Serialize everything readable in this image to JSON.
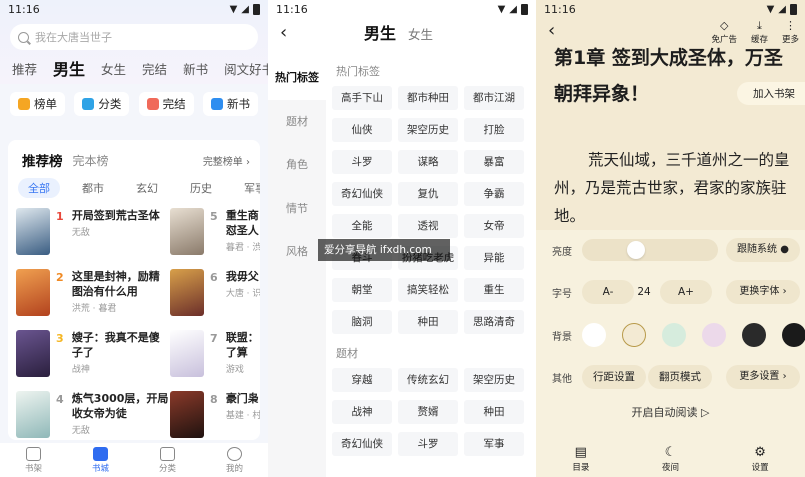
{
  "status": {
    "time": "11:16"
  },
  "home": {
    "search_placeholder": "我在大唐当世子",
    "tabs": [
      "推荐",
      "男生",
      "女生",
      "完结",
      "新书",
      "阅文好书"
    ],
    "active_tab": 1,
    "shortcuts": [
      {
        "label": "榜单",
        "color": "#f5a623"
      },
      {
        "label": "分类",
        "color": "#2fa3e6"
      },
      {
        "label": "完结",
        "color": "#f06a5a"
      },
      {
        "label": "新书",
        "color": "#2f8ef0"
      }
    ],
    "rank": {
      "title": "推荐榜",
      "subtitle": "完本榜",
      "more": "完整榜单",
      "chips": [
        "全部",
        "都市",
        "玄幻",
        "历史",
        "军事"
      ],
      "active_chip": 0,
      "books": [
        {
          "no": "1",
          "name": "开局签到荒古圣体",
          "author": "无敌",
          "cover": "#3a5d82",
          "color": "#e8473a"
        },
        {
          "no": "5",
          "name": "重生商",
          "name2": "怼圣人",
          "author": "暮君 · 渋",
          "cover": "#8a7a6a",
          "color": "#999999"
        },
        {
          "no": "2",
          "name": "这里是封神，励精图治有什么用",
          "author": "洪荒 · 暮君",
          "cover": "#b2421e",
          "color": "#f08a24"
        },
        {
          "no": "6",
          "name": "我毋父",
          "name2": "",
          "author": "大唐 · 识",
          "cover": "#6b2e2a",
          "color": "#999999"
        },
        {
          "no": "3",
          "name": "嫂子：我真不是傻子了",
          "author": "战神",
          "cover": "#2a1f3d",
          "color": "#f5b623"
        },
        {
          "no": "7",
          "name": "联盟：",
          "name2": "了算",
          "author": "游戏",
          "cover": "#e6e2f0",
          "color": "#999999"
        },
        {
          "no": "4",
          "name": "炼气3000层，开局收女帝为徒",
          "author": "无敌",
          "cover": "#c9dde0",
          "color": "#999999"
        },
        {
          "no": "8",
          "name": "豪门枭",
          "name2": "",
          "author": "基建 · 村",
          "cover": "#3a1f1a",
          "color": "#999999"
        }
      ]
    },
    "nav": [
      "书架",
      "书城",
      "分类",
      "我的"
    ],
    "active_nav": 1
  },
  "category": {
    "gender_active": "男生",
    "gender_other": "女生",
    "side": [
      "热门标签",
      "题材",
      "角色",
      "情节",
      "风格"
    ],
    "active_side": 0,
    "section1_title": "热门标签",
    "section1_tags": [
      "高手下山",
      "都市种田",
      "都市江湖",
      "仙侠",
      "架空历史",
      "打脸",
      "斗罗",
      "谋略",
      "暴富",
      "奇幻仙侠",
      "复仇",
      "争霸",
      "全能",
      "透视",
      "女帝",
      "眷斗",
      "扮猪吃老虎",
      "异能",
      "朝堂",
      "搞笑轻松",
      "重生",
      "脑洞",
      "种田",
      "思路清奇"
    ],
    "section2_title": "题材",
    "section2_tags": [
      "穿越",
      "传统玄幻",
      "架空历史",
      "战神",
      "赘婿",
      "种田",
      "奇幻仙侠",
      "斗罗",
      "军事"
    ]
  },
  "watermark": "爱分享导航 ifxdh.com",
  "reader": {
    "actions": [
      {
        "icon": "ad-free-icon",
        "glyph": "◇",
        "label": "免广告"
      },
      {
        "icon": "download-icon",
        "glyph": "⤓",
        "label": "缓存"
      },
      {
        "icon": "more-icon",
        "glyph": "⋮",
        "label": "更多"
      }
    ],
    "chapter_title": "第1章 签到大成圣体，万圣朝拜异象！",
    "add_shelf": "加入书架",
    "paragraph": "荒天仙域，三千道州之一的皇州，乃是荒古世家，君家的家族驻地。",
    "brightness_label": "亮度",
    "brightness_level": 0.38,
    "follow_system": "跟随系统",
    "font_label": "字号",
    "font_minus": "A-",
    "font_size": "24",
    "font_plus": "A+",
    "change_font": "更换字体",
    "bg_label": "背景",
    "bg_colors": [
      "#ffffff",
      "#f3ead3",
      "#d6ecdd",
      "#ecd9ea",
      "#2a2a2a",
      "#1a1a1a"
    ],
    "other_label": "其他",
    "line_setting": "行距设置",
    "page_mode": "翻页模式",
    "more_settings": "更多设置",
    "auto_read": "开启自动阅读",
    "nav": [
      {
        "icon": "contents-icon",
        "label": "目录"
      },
      {
        "icon": "night-icon",
        "label": "夜间"
      },
      {
        "icon": "settings-icon",
        "label": "设置"
      }
    ]
  }
}
